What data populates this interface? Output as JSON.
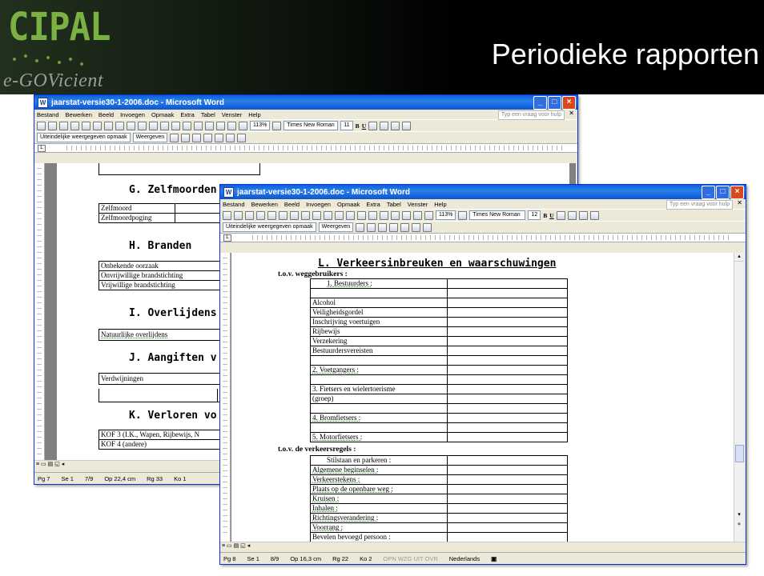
{
  "slide": {
    "logo_mark": "CIPAL",
    "logo_tagline": "e-GOVicient",
    "title": "Periodieke rapporten"
  },
  "window_back": {
    "title": "jaarstat-versie30-1-2006.doc - Microsoft Word",
    "menu": [
      "Bestand",
      "Bewerken",
      "Beeld",
      "Invoegen",
      "Opmaak",
      "Extra",
      "Tabel",
      "Venster",
      "Help"
    ],
    "help_placeholder": "Typ een vraag voor hulp",
    "zoom": "113%",
    "font": "Times New Roman",
    "font_size": "11",
    "style_box": "Uiteindelijke weergegeven opmaak",
    "show_box": "Weergeven",
    "bold": "B",
    "underline": "U",
    "ruler_tab": "L",
    "sections": [
      {
        "heading": "G. Zelfmoorden",
        "rows": [
          "Zelfmoord",
          "Zelfmoordpoging"
        ]
      },
      {
        "heading": "H. Branden",
        "rows": [
          "Onbekende oorzaak",
          "Onvrijwillige brandstichting",
          "Vrijwillige brandstichting"
        ]
      },
      {
        "heading": "I. Overlijdens",
        "rows": [
          "Natuurlijke overlijdens"
        ]
      },
      {
        "heading": "J. Aangiften v",
        "rows": [
          "Verdwijningen"
        ]
      },
      {
        "heading": "K. Verloren vo",
        "rows": [
          "KOF 3 (I.K., Wapen, Rijbewijs, N",
          "KOF 4 (andere)"
        ]
      }
    ],
    "status": {
      "page": "Pg 7",
      "section": "Se 1",
      "pages": "7/9",
      "position": "Op 22,4 cm",
      "line": "Rg 33",
      "col": "Ko 1"
    }
  },
  "window_front": {
    "title": "jaarstat-versie30-1-2006.doc - Microsoft Word",
    "menu": [
      "Bestand",
      "Bewerken",
      "Beeld",
      "Invoegen",
      "Opmaak",
      "Extra",
      "Tabel",
      "Venster",
      "Help"
    ],
    "help_placeholder": "Typ een vraag voor hulp",
    "zoom": "113%",
    "font": "Times New Roman",
    "font_size": "12",
    "style_box": "Uiteindelijke weergegeven opmaak",
    "show_box": "Weergeven",
    "bold": "B",
    "underline": "U",
    "ruler_tab": "L",
    "heading": "L. Verkeersinbreuken en waarschuwingen",
    "sub1": "t.o.v. weggebruikers :",
    "table1": [
      "1.        Bestuurders :",
      "",
      "Alcohol",
      "Veiligheidsgordel",
      "Inschrijving voertuigen",
      "Rijbewijs",
      "Verzekering",
      "Bestuurdersvereisten",
      "",
      "2.   Voetgangers :",
      "",
      "3.   Fietsers en wielertoerisme",
      "(groep)",
      "",
      "4.   Bromfietsers :",
      "",
      "5.   Motorfietsers :"
    ],
    "sub2": "t.o.v. de verkeersregels :",
    "table2": [
      "Stilstaan en parkeren :",
      "Algemene beginselen :",
      "Verkeerstekens :",
      "Plaats op de openbare weg :",
      "Kruisen :",
      "Inhalen :",
      "Richtingsverandering :",
      "Voorrang :",
      "Bevelen bevoegd persoon :"
    ],
    "status": {
      "page": "Pg 8",
      "section": "Se 1",
      "pages": "8/9",
      "position": "Op 16,3 cm",
      "line": "Rg 22",
      "col": "Ko 2",
      "flags": "OPN  WZG  UIT  OVR",
      "lang": "Nederlands"
    }
  }
}
